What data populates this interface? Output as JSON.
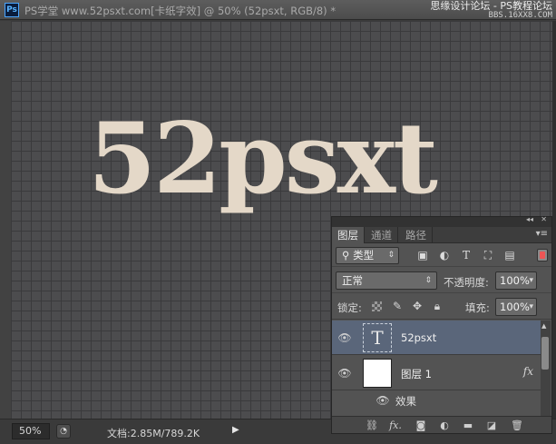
{
  "window": {
    "app_badge": "Ps",
    "title": "PS学堂 www.52psxt.com[卡纸字效] @ 50% (52psxt, RGB/8) *",
    "watermark_line1": "思缘设计论坛 - PS教程论坛",
    "watermark_line2": "BBS.16XX8.COM"
  },
  "canvas": {
    "text": "52psxt",
    "text_color": "#e4d8c8",
    "background_color": "#4c4c4e"
  },
  "status": {
    "zoom": "50%",
    "doc_size": "文档:2.85M/789.2K",
    "arrow": "▶"
  },
  "layers_panel": {
    "tabs": [
      {
        "label": "图层",
        "active": true
      },
      {
        "label": "通道",
        "active": false
      },
      {
        "label": "路径",
        "active": false
      }
    ],
    "filter": {
      "label": "类型"
    },
    "blend_mode": "正常",
    "opacity_label": "不透明度:",
    "opacity_value": "100%",
    "lock_label": "锁定:",
    "fill_label": "填充:",
    "fill_value": "100%",
    "layers": [
      {
        "name": "52psxt",
        "thumb": "T",
        "selected": true
      },
      {
        "name": "图层 1",
        "fx": "fx",
        "selected": false
      }
    ],
    "effects_label": "效果"
  },
  "colors": {
    "selected_layer": "#5a667a",
    "panel_bg": "#535353"
  }
}
